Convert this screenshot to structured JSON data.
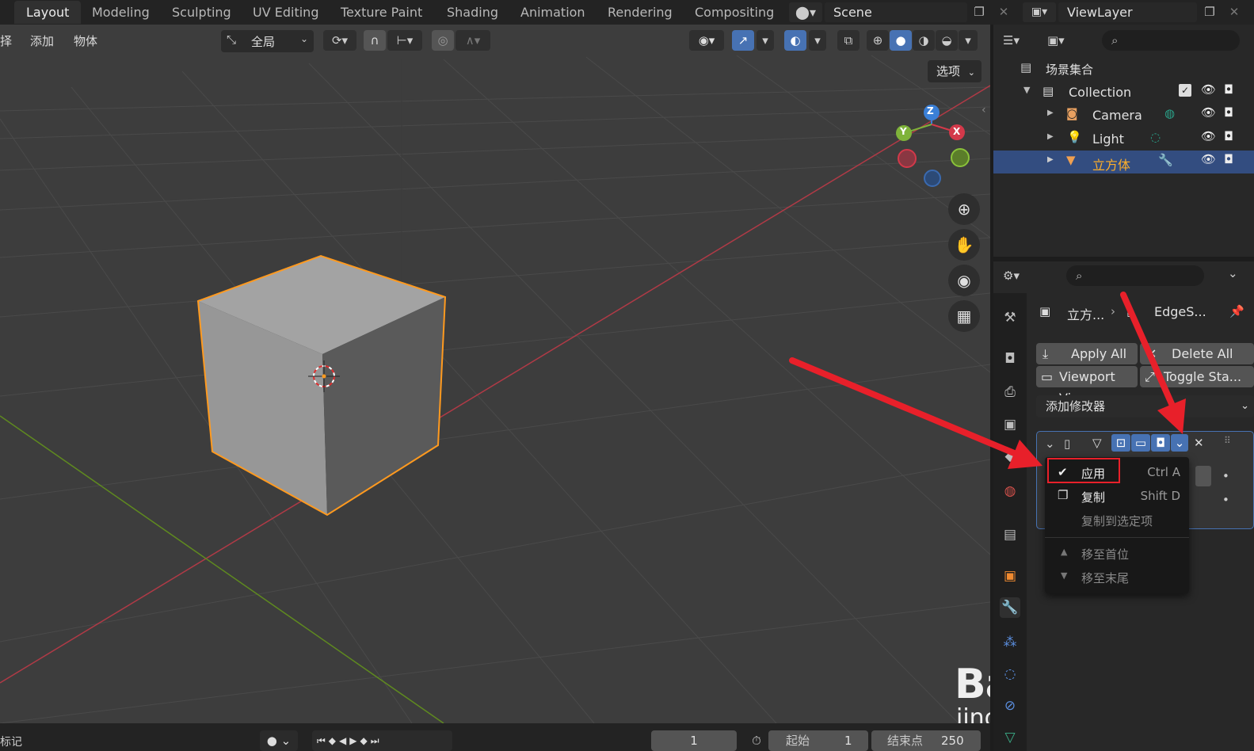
{
  "workspaces": [
    "Layout",
    "Modeling",
    "Sculpting",
    "UV Editing",
    "Texture Paint",
    "Shading",
    "Animation",
    "Rendering",
    "Compositing"
  ],
  "scene": "Scene",
  "view_layer": "ViewLayer",
  "viewport_header": {
    "menu_select": "择",
    "menu_add": "添加",
    "menu_object": "物体",
    "orientation": "全局",
    "options": "选项"
  },
  "gizmo_axes": {
    "x": "X",
    "y": "Y",
    "z": "Z"
  },
  "outliner": {
    "scene_collection": "场景集合",
    "collection": "Collection",
    "items": [
      "Camera",
      "Light",
      "立方体"
    ]
  },
  "properties": {
    "breadcrumb_object": "立方...",
    "breadcrumb_modifier": "EdgeS...",
    "apply_all": "Apply All",
    "delete_all": "Delete All",
    "viewport_vis": "Viewport Vis",
    "toggle_stack": "Toggle Sta...",
    "add_modifier": "添加修改器"
  },
  "context_menu": {
    "apply": "应用",
    "apply_shortcut": "Ctrl A",
    "duplicate": "复制",
    "duplicate_shortcut": "Shift D",
    "copy_to_selected": "复制到选定项",
    "move_first": "移至首位",
    "move_last": "移至末尾"
  },
  "timeline": {
    "markers": "标记",
    "current_frame": "1",
    "start_label": "起始",
    "start": "1",
    "end_label": "结束点",
    "end": "250"
  },
  "watermark": {
    "logo": "Bai du 经验",
    "url": "jingyan.baidu.com"
  },
  "colors": {
    "accent": "#4772b3",
    "selection": "#ff9a1f",
    "annotation_red": "#e8202a",
    "x_axis": "#d2323e",
    "y_axis": "#6c9e1e"
  }
}
